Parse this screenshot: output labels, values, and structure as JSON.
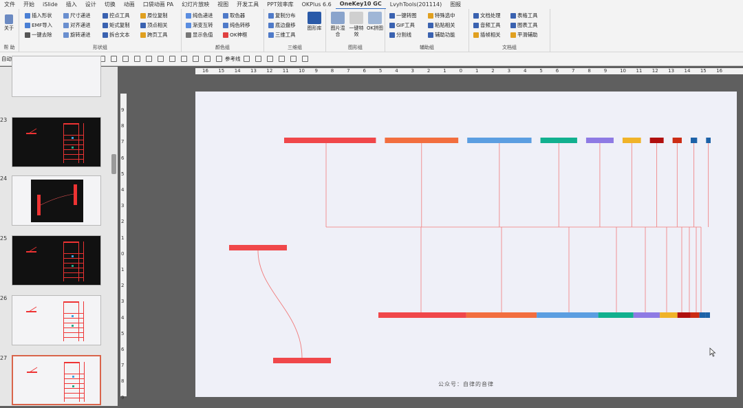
{
  "menu": {
    "tabs": [
      "文件",
      "开始",
      "iSlide",
      "插入",
      "设计",
      "切换",
      "动画",
      "口袋动画 PA",
      "幻灯片放映",
      "视图",
      "开发工具",
      "PPT效率库",
      "OKPlus 6.6",
      "OneKey10 GC",
      "LvyhTools(201114)",
      "图报"
    ],
    "active_index": 13
  },
  "ribbon": {
    "about": {
      "label": "关于",
      "group_label": "帮 助"
    },
    "shape_group": {
      "label": "形状组",
      "items": [
        "插入形状",
        "EMF导入",
        "一键去除",
        "尺寸递进",
        "对齐递进",
        "旋转递进",
        "控点工具",
        "矩式复制",
        "拆合文本",
        "原位复制",
        "顶点相关",
        "跨页工具"
      ]
    },
    "color_group": {
      "label": "颜色组",
      "items": [
        "纯色递进",
        "渐变互转",
        "显示色值",
        "取色器",
        "纯色转移",
        "OK神框"
      ]
    },
    "3d_group": {
      "label": "三维组",
      "items": [
        "复制分布",
        "底边盘移",
        "三维工具"
      ],
      "big": "图形库"
    },
    "image_group": {
      "label": "图形组",
      "bigs": [
        "图片混合",
        "一键特效",
        "OK拼图"
      ]
    },
    "assist_group": {
      "label": "辅助组",
      "items": [
        "一键转图",
        "GIF工具",
        "分割线",
        "特殊选中",
        "粘贴相关",
        "辅助功能"
      ]
    },
    "doc_group": {
      "label": "文档组",
      "items": [
        "文档处理",
        "音频工具",
        "插帧相关",
        "表格工具",
        "图表工具",
        "平滑辅助"
      ]
    }
  },
  "qat": {
    "autosave_label": "自动保存",
    "autosave_state": "关",
    "ref_line_label": "参考线"
  },
  "thumbnails": [
    {
      "number": "23"
    },
    {
      "number": "24"
    },
    {
      "number": "25"
    },
    {
      "number": "26"
    },
    {
      "number": "27"
    }
  ],
  "rulers": {
    "h_ticks": [
      "16",
      "15",
      "14",
      "13",
      "12",
      "11",
      "10",
      "9",
      "8",
      "7",
      "6",
      "5",
      "4",
      "3",
      "2",
      "1",
      "0",
      "1",
      "2",
      "3",
      "4",
      "5",
      "6",
      "7",
      "8",
      "9",
      "10",
      "11",
      "12",
      "13",
      "14",
      "15",
      "16"
    ],
    "v_ticks": [
      "9",
      "8",
      "7",
      "6",
      "5",
      "4",
      "3",
      "2",
      "1",
      "0",
      "1",
      "2",
      "3",
      "4",
      "5",
      "6",
      "7",
      "8",
      "9"
    ]
  },
  "slide": {
    "footer_text": "公众号：自律的音律",
    "colors": [
      "#f0474a",
      "#f26e3f",
      "#5b9ee1",
      "#11b08f",
      "#8e7ae4",
      "#f0b328",
      "#b00f0e",
      "#cc2c14",
      "#1d62a8",
      "#1d62a8"
    ],
    "top_bar_weights": [
      1,
      0.8,
      0.7,
      0.4,
      0.3,
      0.2,
      0.15,
      0.1,
      0.07,
      0.05
    ]
  }
}
